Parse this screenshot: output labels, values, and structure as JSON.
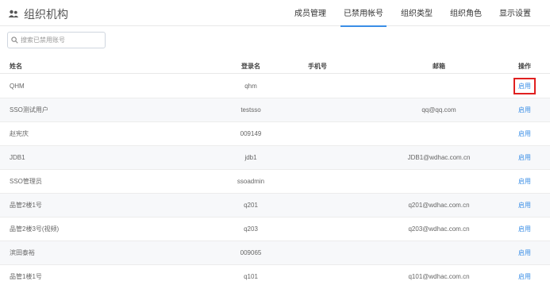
{
  "header": {
    "title": "组织机构",
    "tabs": [
      {
        "label": "成员管理",
        "active": false
      },
      {
        "label": "已禁用帐号",
        "active": true
      },
      {
        "label": "组织类型",
        "active": false
      },
      {
        "label": "组织角色",
        "active": false
      },
      {
        "label": "显示设置",
        "active": false
      }
    ]
  },
  "search": {
    "placeholder": "搜索已禁用账号",
    "value": ""
  },
  "table": {
    "columns": {
      "name": "姓名",
      "login": "登录名",
      "phone": "手机号",
      "email": "邮箱",
      "op": "操作"
    },
    "rows": [
      {
        "name": "QHM",
        "login": "qhm",
        "phone": "",
        "email": "",
        "action": "启用"
      },
      {
        "name": "SSO测试用户",
        "login": "testsso",
        "phone": "",
        "email": "qq@qq.com",
        "action": "启用"
      },
      {
        "name": "赵宪庆",
        "login": "009149",
        "phone": "",
        "email": "",
        "action": "启用"
      },
      {
        "name": "JDB1",
        "login": "jdb1",
        "phone": "",
        "email": "JDB1@wdhac.com.cn",
        "action": "启用"
      },
      {
        "name": "SSO管理员",
        "login": "ssoadmin",
        "phone": "",
        "email": "",
        "action": "启用"
      },
      {
        "name": "品管2楼1号",
        "login": "q201",
        "phone": "",
        "email": "q201@wdhac.com.cn",
        "action": "启用"
      },
      {
        "name": "品管2楼3号(视频)",
        "login": "q203",
        "phone": "",
        "email": "q203@wdhac.com.cn",
        "action": "启用"
      },
      {
        "name": "滨田泰裕",
        "login": "009065",
        "phone": "",
        "email": "",
        "action": "启用"
      },
      {
        "name": "品管1楼1号",
        "login": "q101",
        "phone": "",
        "email": "q101@wdhac.com.cn",
        "action": "启用"
      }
    ]
  },
  "colors": {
    "accent": "#3a8ee6",
    "highlight": "#e02020"
  }
}
